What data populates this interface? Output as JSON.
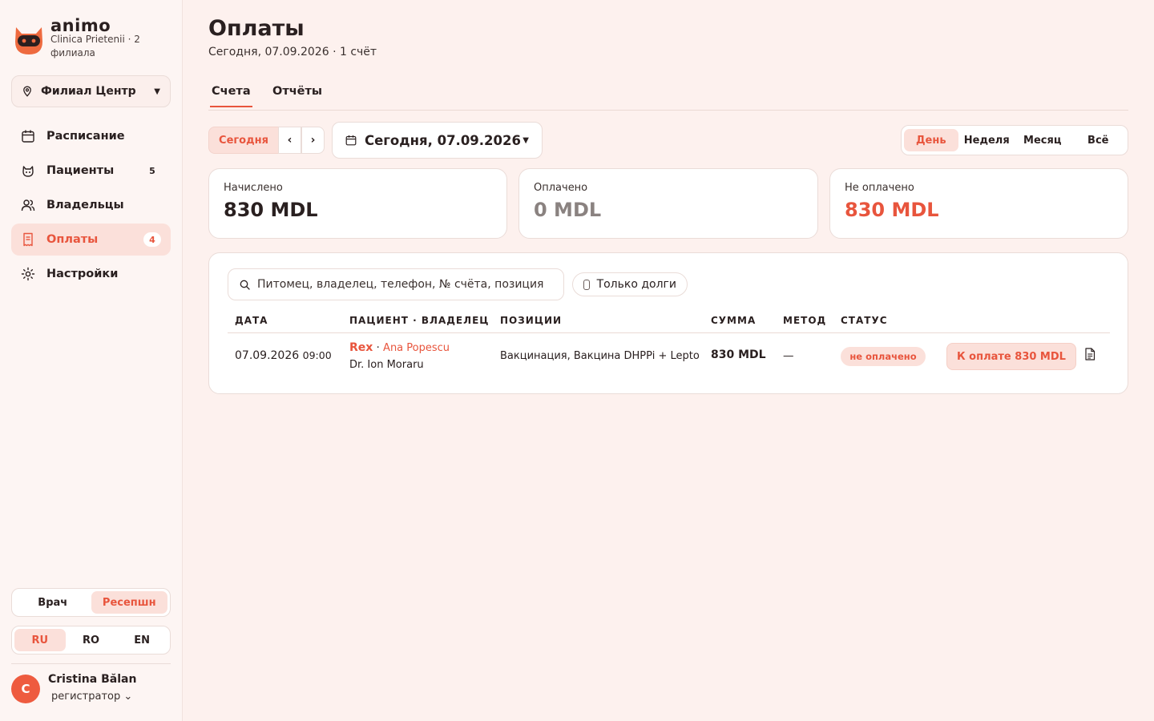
{
  "brand": {
    "name": "animo",
    "subtitle": "Clinica Prietenii · 2 филиала"
  },
  "branch_selector": {
    "label": "Филиал Центр",
    "icon": "location-pin-icon"
  },
  "nav": [
    {
      "label": "Расписание",
      "icon": "calendar-icon",
      "badge": "",
      "active": false
    },
    {
      "label": "Пациенты",
      "icon": "paw-icon",
      "badge": "5",
      "active": false
    },
    {
      "label": "Владельцы",
      "icon": "users-icon",
      "badge": "",
      "active": false
    },
    {
      "label": "Оплаты",
      "icon": "receipt-icon",
      "badge": "4",
      "active": true
    },
    {
      "label": "Настройки",
      "icon": "gear-icon",
      "badge": "",
      "active": false
    }
  ],
  "role_switch": {
    "options": [
      "Врач",
      "Ресепшн"
    ],
    "selected": "Ресепшн"
  },
  "lang_switch": {
    "options": [
      "RU",
      "RO",
      "EN"
    ],
    "selected": "RU"
  },
  "user": {
    "initial": "C",
    "name": "Cristina Bălan",
    "role": "регистратор"
  },
  "page": {
    "title": "Оплаты",
    "subtitle": "Сегодня, 07.09.2026 · 1 счёт"
  },
  "tabs": [
    {
      "label": "Счета",
      "active": true
    },
    {
      "label": "Отчёты",
      "active": false
    }
  ],
  "date_nav": {
    "today_label": "Сегодня",
    "prev": "‹",
    "next": "›",
    "current": "Сегодня, 07.09.2026"
  },
  "period": {
    "options": [
      "День",
      "Неделя",
      "Месяц",
      "Всё"
    ],
    "selected": "День"
  },
  "summary": {
    "charged": {
      "label": "Начислено",
      "value": "830 MDL"
    },
    "paid": {
      "label": "Оплачено",
      "value": "0 MDL"
    },
    "unpaid": {
      "label": "Не оплачено",
      "value": "830 MDL"
    }
  },
  "filters": {
    "search_placeholder": "Питомец, владелец, телефон, № счёта, позиция",
    "debts_only_label": "Только долги",
    "debts_only_checked": false
  },
  "table": {
    "columns": [
      "ДАТА",
      "ПАЦИЕНТ · ВЛАДЕЛЕЦ",
      "ПОЗИЦИИ",
      "СУММА",
      "МЕТОД",
      "СТАТУС"
    ],
    "rows": [
      {
        "date": "07.09.2026",
        "time": "09:00",
        "pet": "Rex",
        "owner": "Ana Popescu",
        "doctor": "Dr. Ion Moraru",
        "items": "Вакцинация, Вакцина DHPPi + Lepto",
        "amount": "830 MDL",
        "method": "—",
        "status": "не оплачено",
        "pay_action": "К оплате 830 MDL"
      }
    ]
  },
  "colors": {
    "accent": "#e8553d",
    "accent_soft": "#fbe0da",
    "background": "#fdf1ee",
    "paid_muted": "#8a8280"
  }
}
